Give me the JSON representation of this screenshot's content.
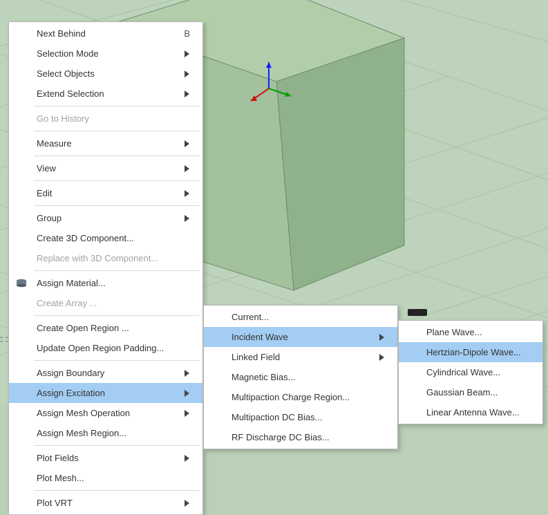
{
  "menu1": {
    "items": [
      {
        "label": "Next Behind",
        "shortcut": "B"
      },
      {
        "label": "Selection Mode",
        "submenu": true
      },
      {
        "label": "Select Objects",
        "submenu": true
      },
      {
        "label": "Extend Selection",
        "submenu": true
      },
      "---",
      {
        "label": "Go to History",
        "disabled": true
      },
      "---",
      {
        "label": "Measure",
        "submenu": true
      },
      "---",
      {
        "label": "View",
        "submenu": true
      },
      "---",
      {
        "label": "Edit",
        "submenu": true
      },
      "---",
      {
        "label": "Group",
        "submenu": true
      },
      {
        "label": "Create 3D Component..."
      },
      {
        "label": "Replace with 3D Component...",
        "disabled": true
      },
      "---",
      {
        "label": "Assign Material...",
        "icon": "material"
      },
      {
        "label": "Create Array ...",
        "disabled": true
      },
      "---",
      {
        "label": "Create Open Region ..."
      },
      {
        "label": "Update Open Region Padding..."
      },
      "---",
      {
        "label": "Assign Boundary",
        "submenu": true
      },
      {
        "label": "Assign Excitation",
        "submenu": true,
        "highlight": true
      },
      {
        "label": "Assign Mesh Operation",
        "submenu": true
      },
      {
        "label": "Assign Mesh Region..."
      },
      "---",
      {
        "label": "Plot Fields",
        "submenu": true
      },
      {
        "label": "Plot Mesh..."
      },
      "---",
      {
        "label": "Plot VRT",
        "submenu": true
      }
    ]
  },
  "menu2": {
    "items": [
      {
        "label": "Current..."
      },
      {
        "label": "Incident Wave",
        "submenu": true,
        "highlight": true
      },
      {
        "label": "Linked Field",
        "submenu": true
      },
      {
        "label": "Magnetic Bias..."
      },
      {
        "label": "Multipaction Charge Region..."
      },
      {
        "label": "Multipaction DC Bias..."
      },
      {
        "label": "RF Discharge DC Bias..."
      }
    ]
  },
  "menu3": {
    "items": [
      {
        "label": "Plane Wave..."
      },
      {
        "label": "Hertzian-Dipole Wave...",
        "highlight": true
      },
      {
        "label": "Cylindrical Wave..."
      },
      {
        "label": "Gaussian Beam..."
      },
      {
        "label": "Linear Antenna Wave..."
      }
    ]
  }
}
